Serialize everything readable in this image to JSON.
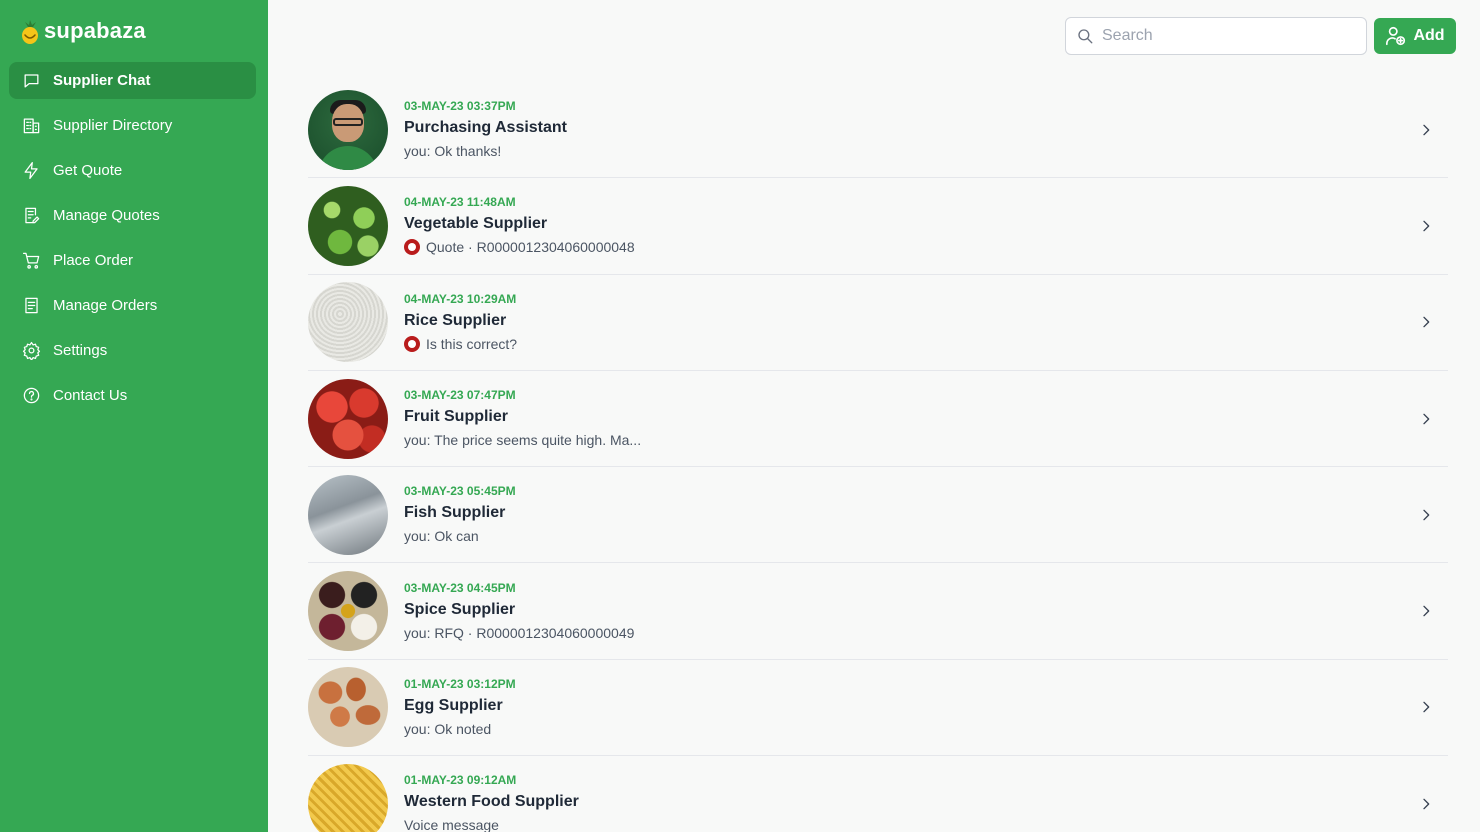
{
  "app": {
    "brand": "supabaza",
    "colors": {
      "primary": "#35a853",
      "active_nav": "#2a8f44",
      "timestamp": "#35a853",
      "quote_dot": "#b91c1c"
    }
  },
  "sidebar": {
    "items": [
      {
        "label": "Supplier Chat",
        "icon": "chat-bubble-icon",
        "active": true
      },
      {
        "label": "Supplier Directory",
        "icon": "building-icon",
        "active": false
      },
      {
        "label": "Get Quote",
        "icon": "lightning-icon",
        "active": false
      },
      {
        "label": "Manage Quotes",
        "icon": "document-edit-icon",
        "active": false
      },
      {
        "label": "Place Order",
        "icon": "cart-icon",
        "active": false
      },
      {
        "label": "Manage Orders",
        "icon": "document-list-icon",
        "active": false
      },
      {
        "label": "Settings",
        "icon": "gear-icon",
        "active": false
      },
      {
        "label": "Contact Us",
        "icon": "question-icon",
        "active": false
      }
    ]
  },
  "header": {
    "search_placeholder": "Search",
    "add_label": "Add"
  },
  "chats": [
    {
      "timestamp": "03-MAY-23 03:37PM",
      "name": "Purchasing Assistant",
      "message": "you: Ok thanks!",
      "status_dot": false,
      "avatar": "person"
    },
    {
      "timestamp": "04-MAY-23 11:48AM",
      "name": "Vegetable Supplier",
      "message": "Quote · R0000012304060000048",
      "status_dot": true,
      "avatar": "vegetable"
    },
    {
      "timestamp": "04-MAY-23 10:29AM",
      "name": "Rice Supplier",
      "message": "Is this correct?",
      "status_dot": true,
      "avatar": "rice"
    },
    {
      "timestamp": "03-MAY-23 07:47PM",
      "name": "Fruit Supplier",
      "message": "you: The price seems quite high. Ma...",
      "status_dot": false,
      "avatar": "fruit"
    },
    {
      "timestamp": "03-MAY-23 05:45PM",
      "name": "Fish Supplier",
      "message": "you: Ok can",
      "status_dot": false,
      "avatar": "fish"
    },
    {
      "timestamp": "03-MAY-23 04:45PM",
      "name": "Spice Supplier",
      "message": "you: RFQ · R0000012304060000049",
      "status_dot": false,
      "avatar": "spice"
    },
    {
      "timestamp": "01-MAY-23 03:12PM",
      "name": "Egg Supplier",
      "message": "you: Ok noted",
      "status_dot": false,
      "avatar": "egg"
    },
    {
      "timestamp": "01-MAY-23 09:12AM",
      "name": "Western Food Supplier",
      "message": "Voice message",
      "status_dot": false,
      "avatar": "pasta"
    }
  ]
}
